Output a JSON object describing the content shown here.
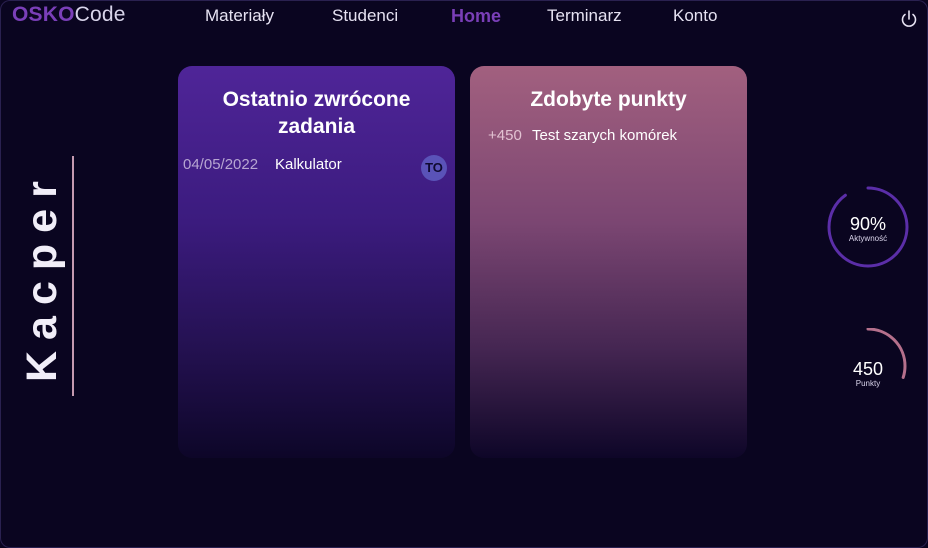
{
  "header": {
    "logo_brand": "OSKO",
    "logo_suffix": "Code",
    "nav": [
      {
        "label": "Materiały",
        "active": false
      },
      {
        "label": "Studenci",
        "active": false
      },
      {
        "label": "Home",
        "active": true
      },
      {
        "label": "Terminarz",
        "active": false
      },
      {
        "label": "Konto",
        "active": false
      }
    ],
    "power_icon": "power-icon"
  },
  "user": {
    "name": "Kacper"
  },
  "cards": {
    "returned": {
      "title": "Ostatnio zwrócone zadania",
      "items": [
        {
          "date": "04/05/2022",
          "name": "Kalkulator",
          "avatar": "TO"
        }
      ]
    },
    "points": {
      "title": "Zdobyte punkty",
      "items": [
        {
          "points": "+450",
          "name": "Test szarych komórek"
        }
      ]
    }
  },
  "stats": {
    "activity": {
      "value": "90%",
      "label": "Aktywność",
      "fraction": 0.9,
      "color": "#5b2ea8"
    },
    "points": {
      "value": "450",
      "label": "Punkty",
      "fraction": 0.3,
      "color": "#b5708c"
    }
  },
  "colors": {
    "background": "#0a0520",
    "accent": "#7a3fb8",
    "card_left": "#4f2598",
    "card_right": "#a2607f"
  }
}
